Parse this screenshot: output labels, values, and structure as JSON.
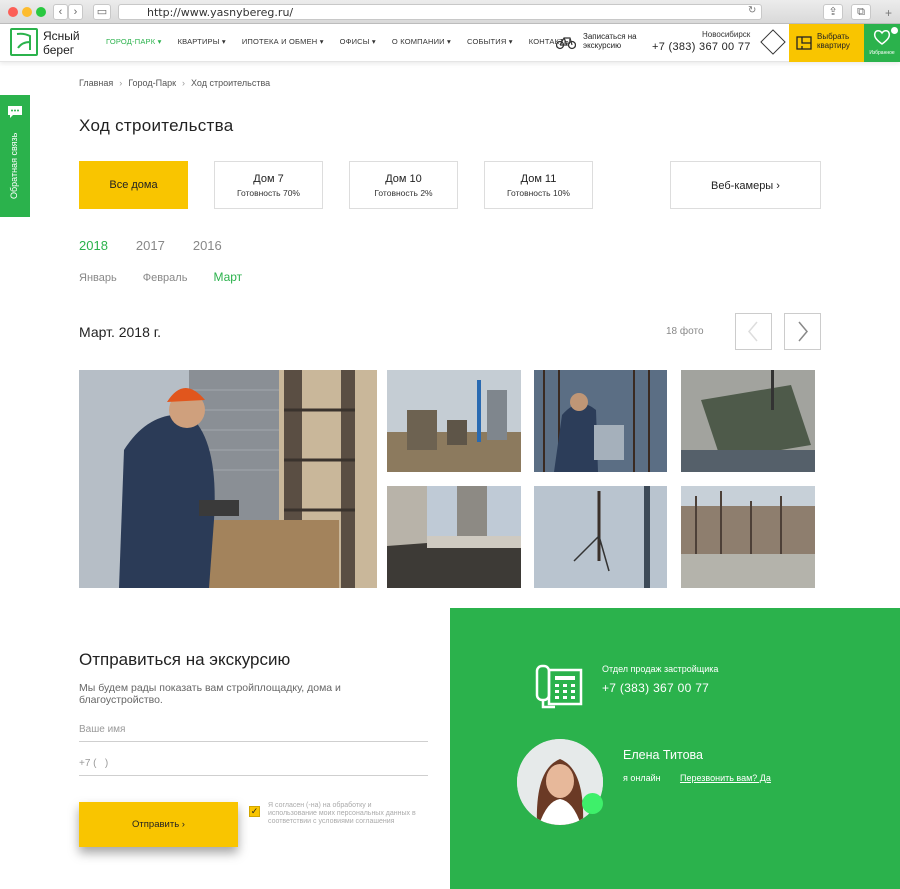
{
  "browser": {
    "url": "http://www.yasnybereg.ru/"
  },
  "header": {
    "logo_line1": "Ясный",
    "logo_line2": "берег",
    "menu": [
      "ГОРОД-ПАРК",
      "КВАРТИРЫ",
      "ИПОТЕКА И ОБМЕН",
      "ОФИСЫ",
      "О КОМПАНИИ",
      "СОБЫТИЯ",
      "КОНТАКТЫ"
    ],
    "tour_line1": "Записаться на",
    "tour_line2": "экскурсию",
    "city": "Новосибирск",
    "phone": "+7 (383) 367 00 77",
    "pick_line1": "Выбрать",
    "pick_line2": "квартиру",
    "fav_label": "Избранное"
  },
  "feedback_tab": "Обратная связь",
  "breadcrumb": [
    "Главная",
    "Город-Парк",
    "Ход строительства"
  ],
  "page_title": "Ход строительства",
  "tabs": [
    {
      "name": "Все дома",
      "progress": ""
    },
    {
      "name": "Дом 7",
      "progress": "Готовность 70%"
    },
    {
      "name": "Дом 10",
      "progress": "Готовность 2%"
    },
    {
      "name": "Дом 11",
      "progress": "Готовность 10%"
    }
  ],
  "webcams": "Веб-камеры",
  "years": [
    "2018",
    "2017",
    "2016"
  ],
  "months": [
    "Январь",
    "Февраль",
    "Март"
  ],
  "gallery": {
    "title": "Март. 2018 г.",
    "count": "18 фото"
  },
  "form": {
    "title": "Отправиться на экскурсию",
    "description": "Мы будем рады показать вам стройплощадку, дома и благоустройство.",
    "name_placeholder": "Ваше имя",
    "phone_placeholder": "+7 (   )",
    "submit": "Отправить",
    "consent": "Я согласен (-на) на обработку и использование моих персональных данных в соответствии с условиями соглашения"
  },
  "contact": {
    "department": "Отдел продаж застройщика",
    "phone": "+7 (383) 367 00 77",
    "manager": "Елена Титова",
    "status": "я онлайн",
    "callback": "Перезвонить вам? Да"
  },
  "colors": {
    "brand_green": "#2bb24c",
    "accent_yellow": "#f9c500"
  }
}
